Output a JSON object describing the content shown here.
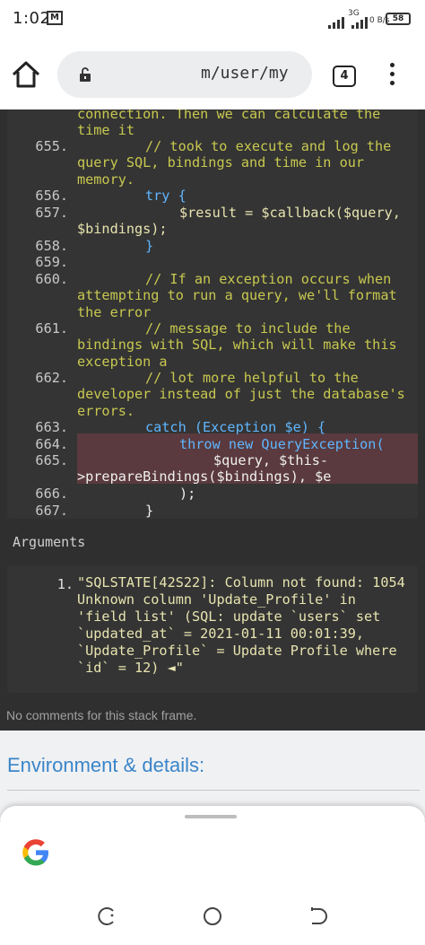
{
  "status_bar": {
    "time": "1:02",
    "mail_icon": "M",
    "network": "3G",
    "speed": "0 B/s",
    "battery": "58"
  },
  "browser": {
    "url": "m/user/my",
    "tab_count": "4"
  },
  "code": {
    "lines": [
      {
        "num": "",
        "text": "connection. Then we can calculate the time it"
      },
      {
        "num": "655.",
        "text": "// took to execute and log the query SQL, bindings and time in our memory."
      },
      {
        "num": "656.",
        "text": "try {"
      },
      {
        "num": "657.",
        "text": "$result = $callback($query, $bindings);"
      },
      {
        "num": "658.",
        "text": "}"
      },
      {
        "num": "659.",
        "text": ""
      },
      {
        "num": "660.",
        "text": "// If an exception occurs when attempting to run a query, we'll format the error"
      },
      {
        "num": "661.",
        "text": "// message to include the bindings with SQL, which will make this exception a"
      },
      {
        "num": "662.",
        "text": "// lot more helpful to the developer instead of just the database's errors."
      },
      {
        "num": "663.",
        "text": "catch (Exception $e) {"
      },
      {
        "num": "664.",
        "text": "throw new QueryException("
      },
      {
        "num": "665.",
        "text": "$query, $this->prepareBindings($bindings), $e"
      },
      {
        "num": "666.",
        "text": ");"
      },
      {
        "num": "667.",
        "text": "}"
      }
    ]
  },
  "arguments": {
    "label": "Arguments",
    "items": [
      {
        "num": "1.",
        "text": "\"SQLSTATE[42S22]: Column not found: 1054 Unknown column 'Update_Profile' in 'field list' (SQL: update `users` set `updated_at` = 2021-01-11 00:01:39, `Update_Profile` = Update Profile where `id` = 12) ◄\""
      }
    ]
  },
  "no_comments": "No comments for this stack frame.",
  "environment": {
    "title": "Environment & details:"
  },
  "colors": {
    "background": "#2f2f2f",
    "code_bg": "#343434",
    "comment": "#c8c850",
    "keyword": "#5fb6ff",
    "class": "#ff8a8a",
    "highlight": "#5a3a3e",
    "env_title": "#3a85c9"
  }
}
